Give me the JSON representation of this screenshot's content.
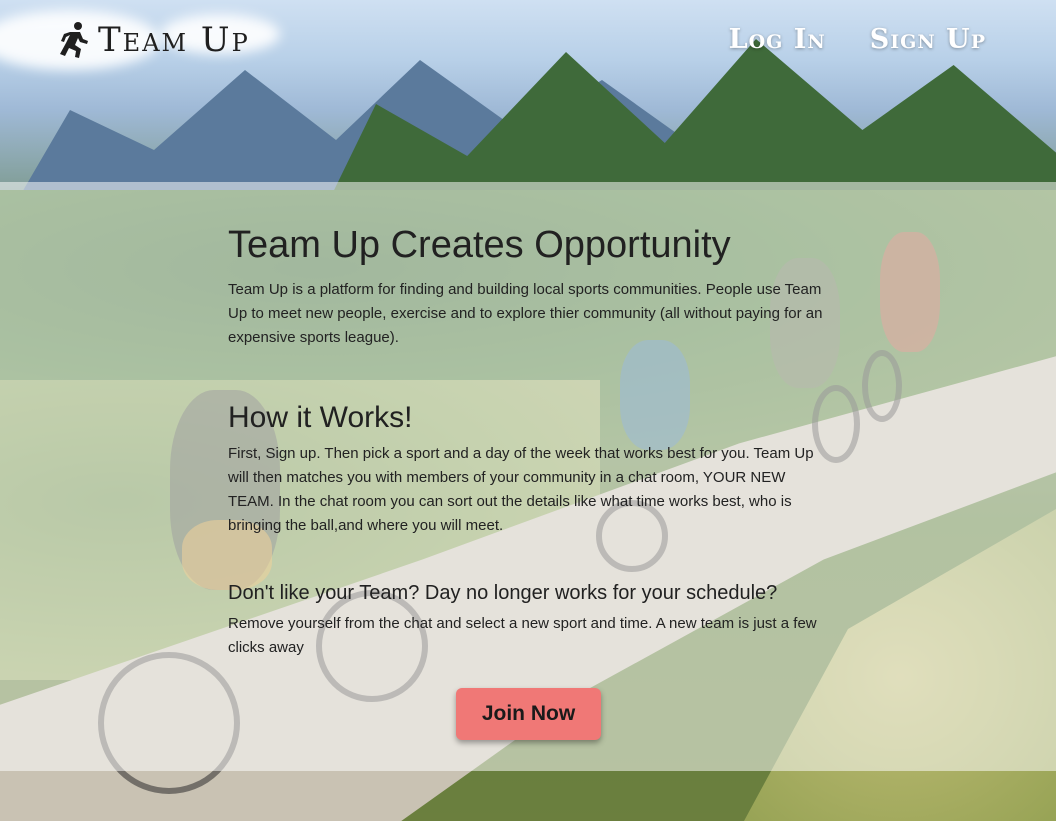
{
  "brand": {
    "name": "Team Up",
    "icon": "running-person-icon"
  },
  "nav": {
    "login_label": "Log In",
    "signup_label": "Sign Up"
  },
  "main": {
    "title": "Team Up Creates Opportunity",
    "intro": "Team Up is a platform for finding and building local sports communities. People use Team Up to meet new people, exercise and to explore thier community (all without paying for an expensive sports league).",
    "how_heading": "How it Works!",
    "how_text": "First, Sign up. Then pick a sport and a day of the week that works best for you. Team Up will then matches you with members of your community in a chat room, YOUR NEW TEAM. In the chat room you can sort out the details like what time works best, who is bringing the ball,and where you will meet.",
    "change_heading": "Don't like your Team? Day no longer works for your schedule?",
    "change_text": "Remove yourself from the chat and select a new sport and time. A new team is just a few clicks away",
    "join_label": "Join Now"
  },
  "colors": {
    "button": "#f07876",
    "panel_overlay": "rgba(255,255,255,0.52)",
    "nav_text": "#ffffff",
    "body_text": "#222222"
  },
  "background": {
    "subject": "mountain-bikers-on-alpine-trail"
  }
}
